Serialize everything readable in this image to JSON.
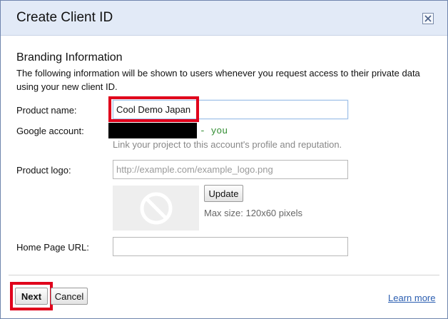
{
  "dialog": {
    "title": "Create Client ID",
    "close_icon": "close-icon"
  },
  "branding": {
    "heading": "Branding Information",
    "description": "The following information will be shown to users whenever you request access to their private data using your new client ID."
  },
  "form": {
    "product_name_label": "Product name:",
    "product_name_value": "Cool Demo Japan",
    "google_account_label": "Google account:",
    "google_account_suffix": "- you",
    "google_account_hint": "Link your project to this account's profile and reputation.",
    "product_logo_label": "Product logo:",
    "product_logo_placeholder": "http://example.com/example_logo.png",
    "logo_preview_icon": "no-image-icon",
    "update_label": "Update",
    "max_size_text": "Max size: 120x60 pixels",
    "home_page_label": "Home Page URL:",
    "home_page_value": ""
  },
  "footer": {
    "next_label": "Next",
    "cancel_label": "Cancel",
    "learn_more_label": "Learn more"
  },
  "colors": {
    "title_bar": "#e2eaf7",
    "highlight": "#e0001b",
    "you_text": "#2e8b2e",
    "link": "#2a5db0"
  }
}
